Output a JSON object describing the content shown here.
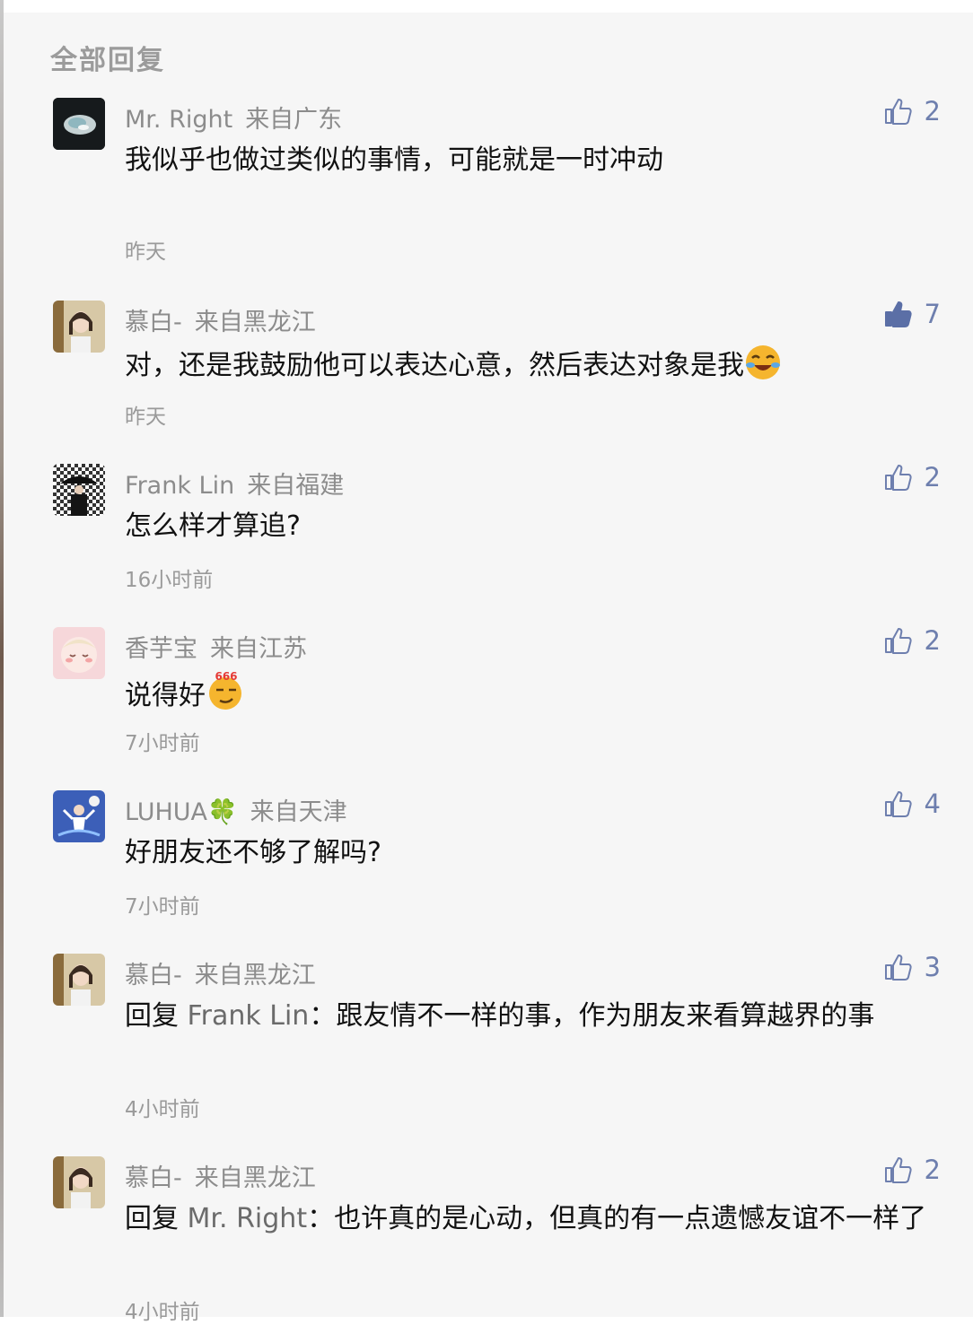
{
  "section_title": "全部回复",
  "comments": [
    {
      "name": "Mr. Right",
      "location": "来自广东",
      "text": "我似乎也做过类似的事情，可能就是一时冲动",
      "time": "昨天",
      "likes": "2",
      "liked": false
    },
    {
      "name": "慕白-",
      "location": "来自黑龙江",
      "text": "对，还是我鼓励他可以表达心意，然后表达对象是我",
      "time": "昨天",
      "likes": "7",
      "liked": true,
      "emoji": "laughing-crying-emoji"
    },
    {
      "name": "Frank Lin",
      "location": "来自福建",
      "text": "怎么样才算追?",
      "time": "16小时前",
      "likes": "2",
      "liked": false
    },
    {
      "name": "香芋宝",
      "location": "来自江苏",
      "text": "说得好",
      "time": "7小时前",
      "likes": "2",
      "liked": false,
      "emoji": "666-emoji"
    },
    {
      "name": "LUHUA",
      "name_badge": "🍀",
      "location": "来自天津",
      "text": "好朋友还不够了解吗?",
      "time": "7小时前",
      "likes": "4",
      "liked": false
    },
    {
      "name": "慕白-",
      "location": "来自黑龙江",
      "reply_prefix": "回复 ",
      "reply_to": "Frank Lin",
      "reply_sep": "：",
      "text": "跟友情不一样的事，作为朋友来看算越界的事",
      "time": "4小时前",
      "likes": "3",
      "liked": false
    },
    {
      "name": "慕白-",
      "location": "来自黑龙江",
      "reply_prefix": "回复 ",
      "reply_to": "Mr. Right",
      "reply_sep": "：",
      "text": "也许真的是心动，但真的有一点遗憾友谊不一样了",
      "time": "4小时前",
      "likes": "2",
      "liked": false
    }
  ],
  "colors": {
    "like_active": "#5b6fa6",
    "like_outline": "#6e7fae",
    "location": "#8c8c8c",
    "panel_bg": "#f6f6f6"
  },
  "emoji_text": {
    "six": "666"
  }
}
